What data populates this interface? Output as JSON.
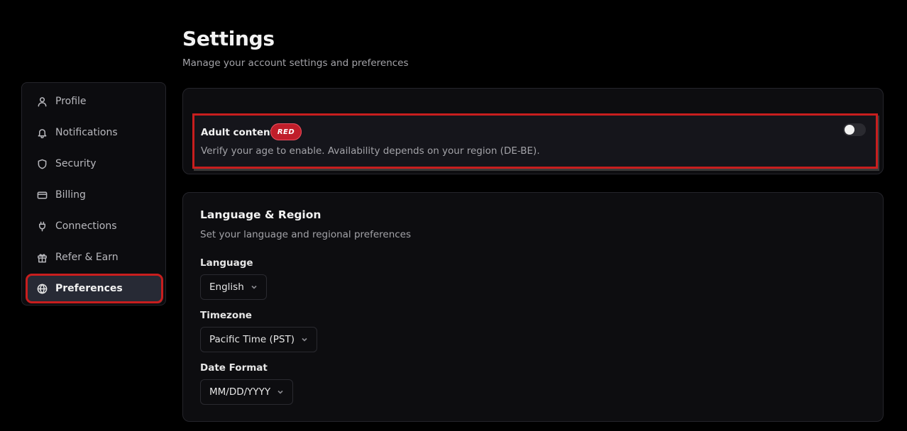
{
  "header": {
    "title": "Settings",
    "subtitle": "Manage your account settings and preferences"
  },
  "sidebar": {
    "items": [
      {
        "label": "Profile",
        "icon": "user-icon"
      },
      {
        "label": "Notifications",
        "icon": "bell-icon"
      },
      {
        "label": "Security",
        "icon": "shield-icon"
      },
      {
        "label": "Billing",
        "icon": "credit-card-icon"
      },
      {
        "label": "Connections",
        "icon": "plug-icon"
      },
      {
        "label": "Refer & Earn",
        "icon": "gift-icon"
      },
      {
        "label": "Preferences",
        "icon": "globe-icon",
        "active": true
      }
    ]
  },
  "adult_content": {
    "title": "Adult content",
    "badge": "RED",
    "description": "Verify your age to enable. Availability depends on your region (DE-BE).",
    "enabled": false
  },
  "language_region": {
    "title": "Language & Region",
    "subtitle": "Set your language and regional preferences",
    "language_label": "Language",
    "language_value": "English",
    "timezone_label": "Timezone",
    "timezone_value": "Pacific Time (PST)",
    "date_format_label": "Date Format",
    "date_format_value": "MM/DD/YYYY"
  },
  "colors": {
    "accent_red": "#c81e1e",
    "badge_red": "#c01e2a",
    "background": "#000000",
    "card": "#0d0d10"
  }
}
